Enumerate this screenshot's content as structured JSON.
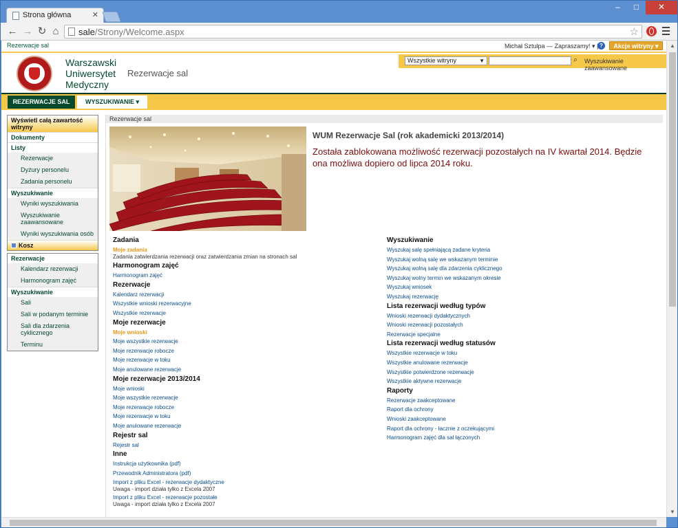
{
  "browser": {
    "tab_title": "Strona główna",
    "url_host": "sale",
    "url_path": "/Strony/Welcome.aspx"
  },
  "topstrip": {
    "breadcrumb": "Rezerwacje sal",
    "user": "Michał Sztulpa — Zapraszamy! ▾  |",
    "site_actions": "Akcje witryny ▾"
  },
  "header": {
    "site_name": "Warszawski Uniwersytet Medyczny",
    "site_title": "Rezerwacje sal",
    "search_scope": "Wszystkie witryny",
    "search_placeholder": "",
    "advanced_search": "Wyszukiwanie zaawansowane"
  },
  "topnav": {
    "home": "REZERWACJE SAL",
    "search": "WYSZUKIWANIE ▾"
  },
  "leftnav": {
    "box1": {
      "view_all": "Wyświetl całą zawartość witryny",
      "documents": "Dokumenty",
      "lists": "Listy",
      "lists_items": [
        "Rezerwacje",
        "Dyżury personelu",
        "Zadania personelu"
      ],
      "search_head": "Wyszukiwanie",
      "search_items": [
        "Wyniki wyszukiwania",
        "Wyszukiwanie zaawansowane",
        "Wyniki wyszukiwania osób"
      ],
      "trash": "Kosz"
    },
    "box2": {
      "reservations_head": "Rezerwacje",
      "reservations_items": [
        "Kalendarz rezerwacji",
        "Harmonogram zajęć"
      ],
      "search_head": "Wyszukiwanie",
      "search_items": [
        "Sali",
        "Sali w podanym terminie",
        "Sali dla zdarzenia cyklicznego",
        "Terminu"
      ]
    }
  },
  "main": {
    "breadcrumb": "Rezerwacje sal",
    "title": "WUM Rezerwacje Sal (rok akademicki 2013/2014)",
    "notice": "Została zablokowana możliwość rezerwacji pozostałych na IV kwartał 2014. Będzie ona możliwa dopiero od lipca 2014 roku."
  },
  "left_col": {
    "zadania_h": "Zadania",
    "zadania_link": "Moje zadania",
    "zadania_desc": "Zadania zatwierdzania rezerwacji oraz zatwierdzania zmian na stronach sal",
    "harm_h": "Harmonogram zajęć",
    "harm_items": [
      "Harmonogram zajęć"
    ],
    "rez_h": "Rezerwacje",
    "rez_items": [
      "Kalendarz rezerwacji",
      "Wszystkie wnioski rezerwacyjne",
      "Wszystkie rezerwacje"
    ],
    "moje_h": "Moje rezerwacje",
    "moje_link": "Moje wnioski",
    "moje_items": [
      "Moje wszystkie rezerwacje",
      "Moje rezerwacje robocze",
      "Moje rezerwacje w toku",
      "Moje anulowane rezerwacje"
    ],
    "moje1314_h": "Moje rezerwacje 2013/2014",
    "moje1314_items": [
      "Moje wnioski",
      "Moje wszystkie rezerwacje",
      "Moje rezerwacje robocze",
      "Moje rezerwacje w toku",
      "Moje anulowane rezerwacje"
    ],
    "rejestr_h": "Rejestr sal",
    "rejestr_items": [
      "Rejestr sal"
    ],
    "inne_h": "Inne",
    "inne_items": [
      "Instrukcja użytkownika (pdf)",
      "Przewodnik Administratora (pdf)"
    ],
    "import1": "Import z pliku Excel - rezerwacje dydaktyczne",
    "import1_note": "Uwaga - import działa tylko z Excela 2007",
    "import2": "Import z pliku Excel - rezerwacje pozostałe",
    "import2_note": "Uwaga - import działa tylko z Excela 2007"
  },
  "right_col": {
    "wysz_h": "Wyszukiwanie",
    "wysz_items": [
      "Wyszukaj salę spełniającą zadane kryteria",
      "Wyszukaj wolną salę we wskazanym terminie",
      "Wyszukaj wolną salę dla zdarzenia cyklicznego",
      "Wyszukaj wolny termin we wskazanym okresie",
      "Wyszukaj wniosek",
      "Wyszukaj rezerwację"
    ],
    "typy_h": "Lista rezerwacji według typów",
    "typy_items": [
      "Wnioski rezerwacji dydaktycznych",
      "Wnioski rezerwacji pozostałych",
      "Rezerwacje specjalne"
    ],
    "status_h": "Lista rezerwacji według statusów",
    "status_items": [
      "Wszystkie rezerwacje w toku",
      "Wszystkie anulowane rezerwacje",
      "Wszystkie potwierdzone rezerwacje",
      "Wszystkie aktywne rezerwacje"
    ],
    "raporty_h": "Raporty",
    "raporty_items": [
      "Rezerwacje zaakceptowane",
      "Raport dla ochrony",
      "Wnioski zaakceptowane",
      "Raport dla ochrony - łacznie z oczekującymi",
      "Harmonogram zajęć dla sal łączonych"
    ]
  },
  "colors": {
    "green": "#064a2e",
    "yellow": "#f6c84a",
    "notice": "#7a0d0d",
    "link": "#0a4d8c"
  }
}
